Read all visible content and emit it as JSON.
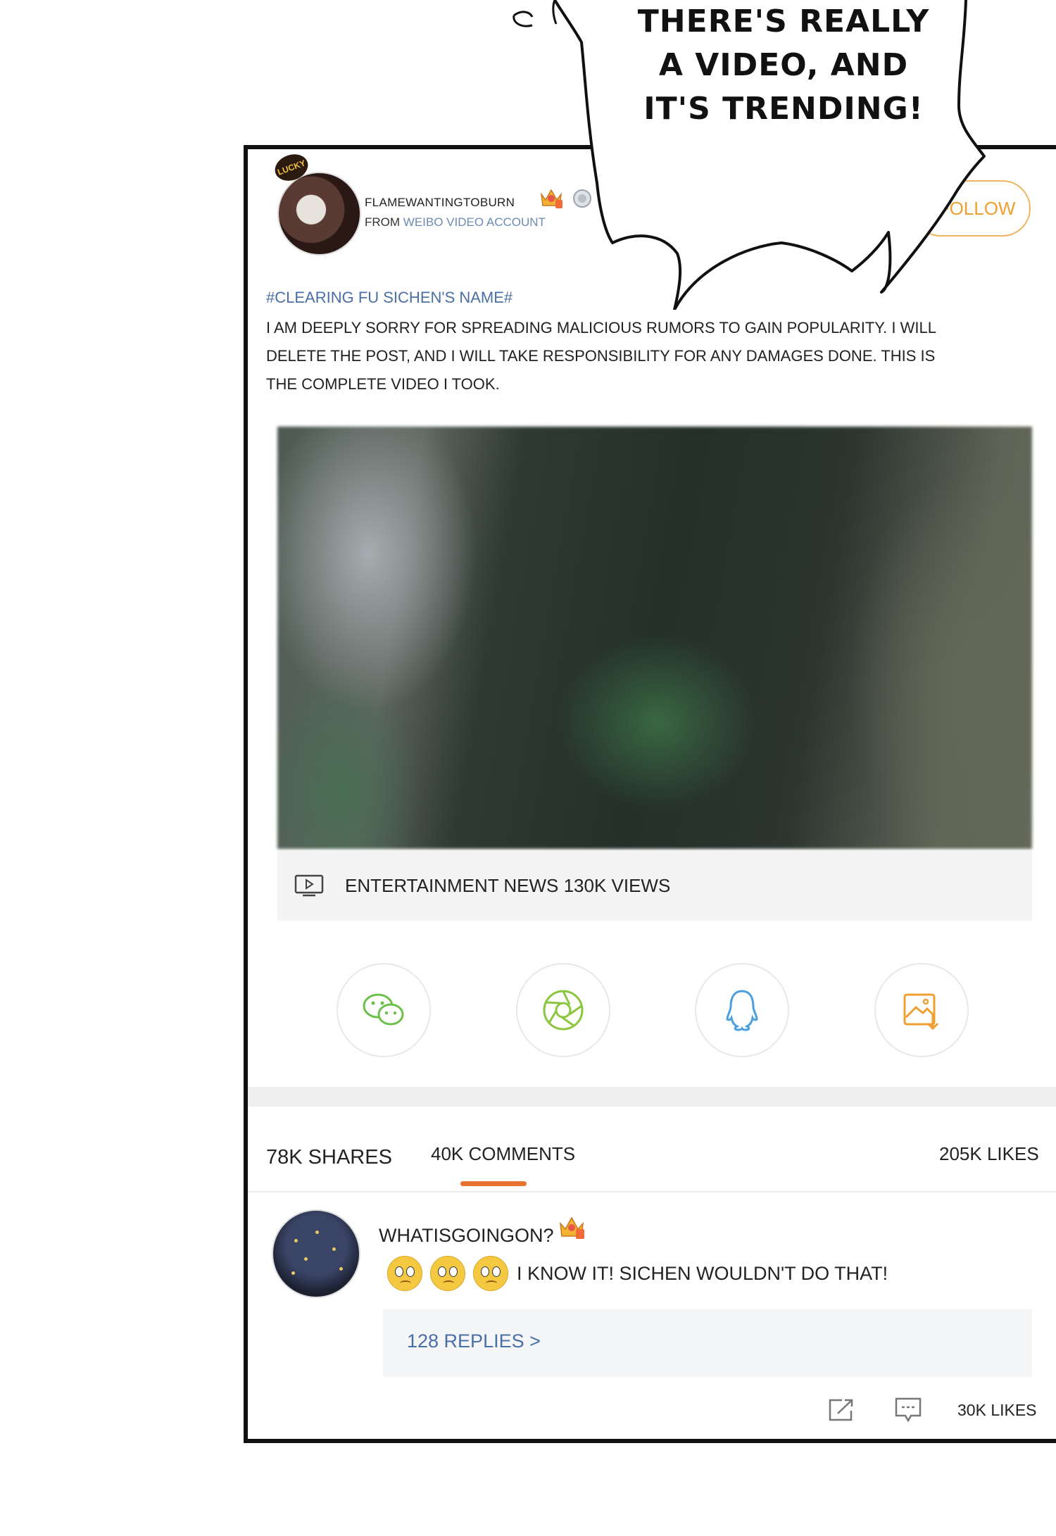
{
  "post": {
    "username": "FLAMEWANTINGTOBURN",
    "from_prefix": "FROM",
    "from_source": "WEIBO VIDEO ACCOUNT",
    "follow_label": "+FOLLOW",
    "badge_text": "LUCKY",
    "hashtag": "#CLEARING FU SICHEN'S NAME#",
    "body": "I AM DEEPLY SORRY FOR SPREADING MALICIOUS RUMORS TO GAIN POPULARITY. I WILL DELETE THE POST, AND I WILL TAKE RESPONSIBILITY FOR ANY DAMAGES DONE. THIS IS THE COMPLETE VIDEO I TOOK.",
    "video_caption": "ENTERTAINMENT NEWS 130K VIEWS"
  },
  "share_targets": [
    {
      "icon": "wechat-icon"
    },
    {
      "icon": "moments-icon"
    },
    {
      "icon": "qq-icon"
    },
    {
      "icon": "save-image-icon"
    }
  ],
  "tabs": {
    "shares": "78K SHARES",
    "comments": "40K COMMENTS",
    "likes": "205K LIKES",
    "active": "comments"
  },
  "comment": {
    "username": "WHATISGOINGON?",
    "text": "I KNOW IT! SICHEN WOULDN'T DO THAT!",
    "replies": "128 REPLIES >",
    "likes": "30K LIKES"
  },
  "bubble": {
    "line1": "THERE'S REALLY",
    "line2": "A VIDEO, AND",
    "line3": "IT'S TRENDING!"
  },
  "colors": {
    "accent_orange": "#e8752f",
    "link_blue": "#4a6fa5",
    "follow_orange": "#f0a030"
  }
}
